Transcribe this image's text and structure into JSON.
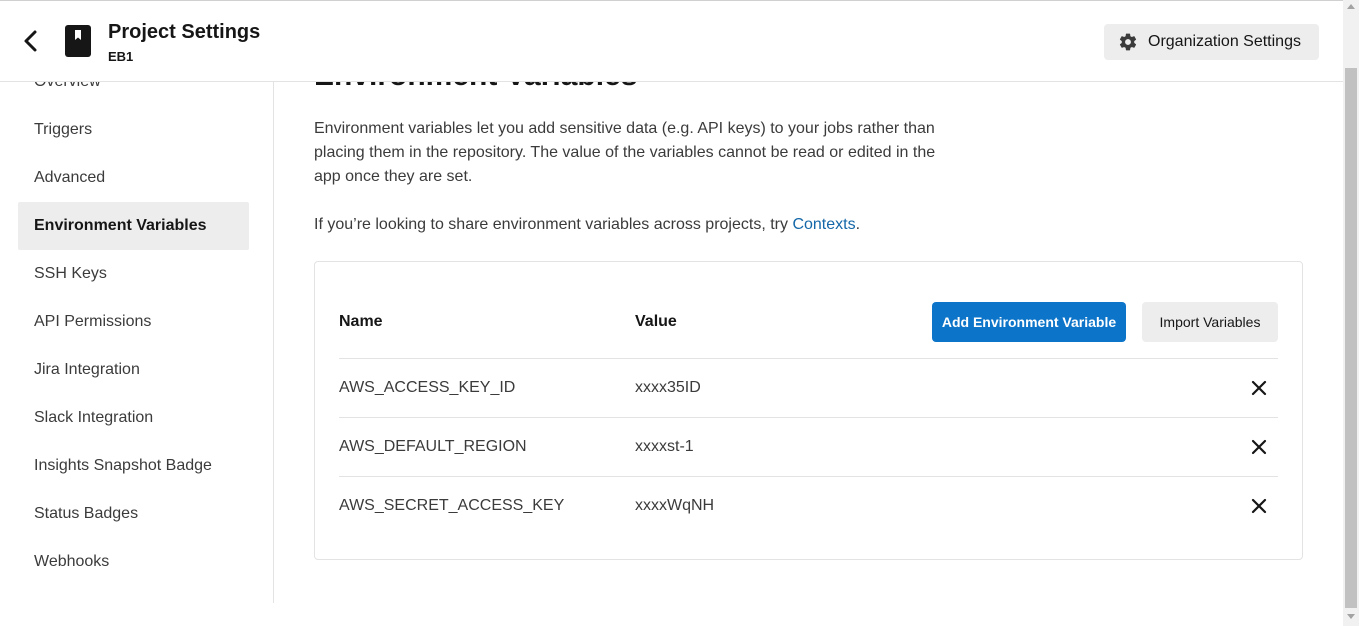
{
  "header": {
    "title": "Project Settings",
    "project": "EB1",
    "org_settings_label": "Organization Settings"
  },
  "sidebar": {
    "items": [
      {
        "label": "Overview"
      },
      {
        "label": "Triggers"
      },
      {
        "label": "Advanced"
      },
      {
        "label": "Environment Variables",
        "active": true
      },
      {
        "label": "SSH Keys"
      },
      {
        "label": "API Permissions"
      },
      {
        "label": "Jira Integration"
      },
      {
        "label": "Slack Integration"
      },
      {
        "label": "Insights Snapshot Badge"
      },
      {
        "label": "Status Badges"
      },
      {
        "label": "Webhooks"
      }
    ]
  },
  "main": {
    "heading": "Environment Variables",
    "description": "Environment variables let you add sensitive data (e.g. API keys) to your jobs rather than placing them in the repository. The value of the variables cannot be read or edited in the app once they are set.",
    "share_prefix": "If you’re looking to share environment variables across projects, try ",
    "share_link": "Contexts",
    "share_suffix": ".",
    "table": {
      "col_name": "Name",
      "col_value": "Value",
      "add_button": "Add Environment Variable",
      "import_button": "Import Variables",
      "rows": [
        {
          "name": "AWS_ACCESS_KEY_ID",
          "value": "xxxx35ID"
        },
        {
          "name": "AWS_DEFAULT_REGION",
          "value": "xxxxst-1"
        },
        {
          "name": "AWS_SECRET_ACCESS_KEY",
          "value": "xxxxWqNH"
        }
      ]
    }
  },
  "colors": {
    "accent": "#0c74c9",
    "link": "#1467a8",
    "active_bg": "#ededed"
  }
}
